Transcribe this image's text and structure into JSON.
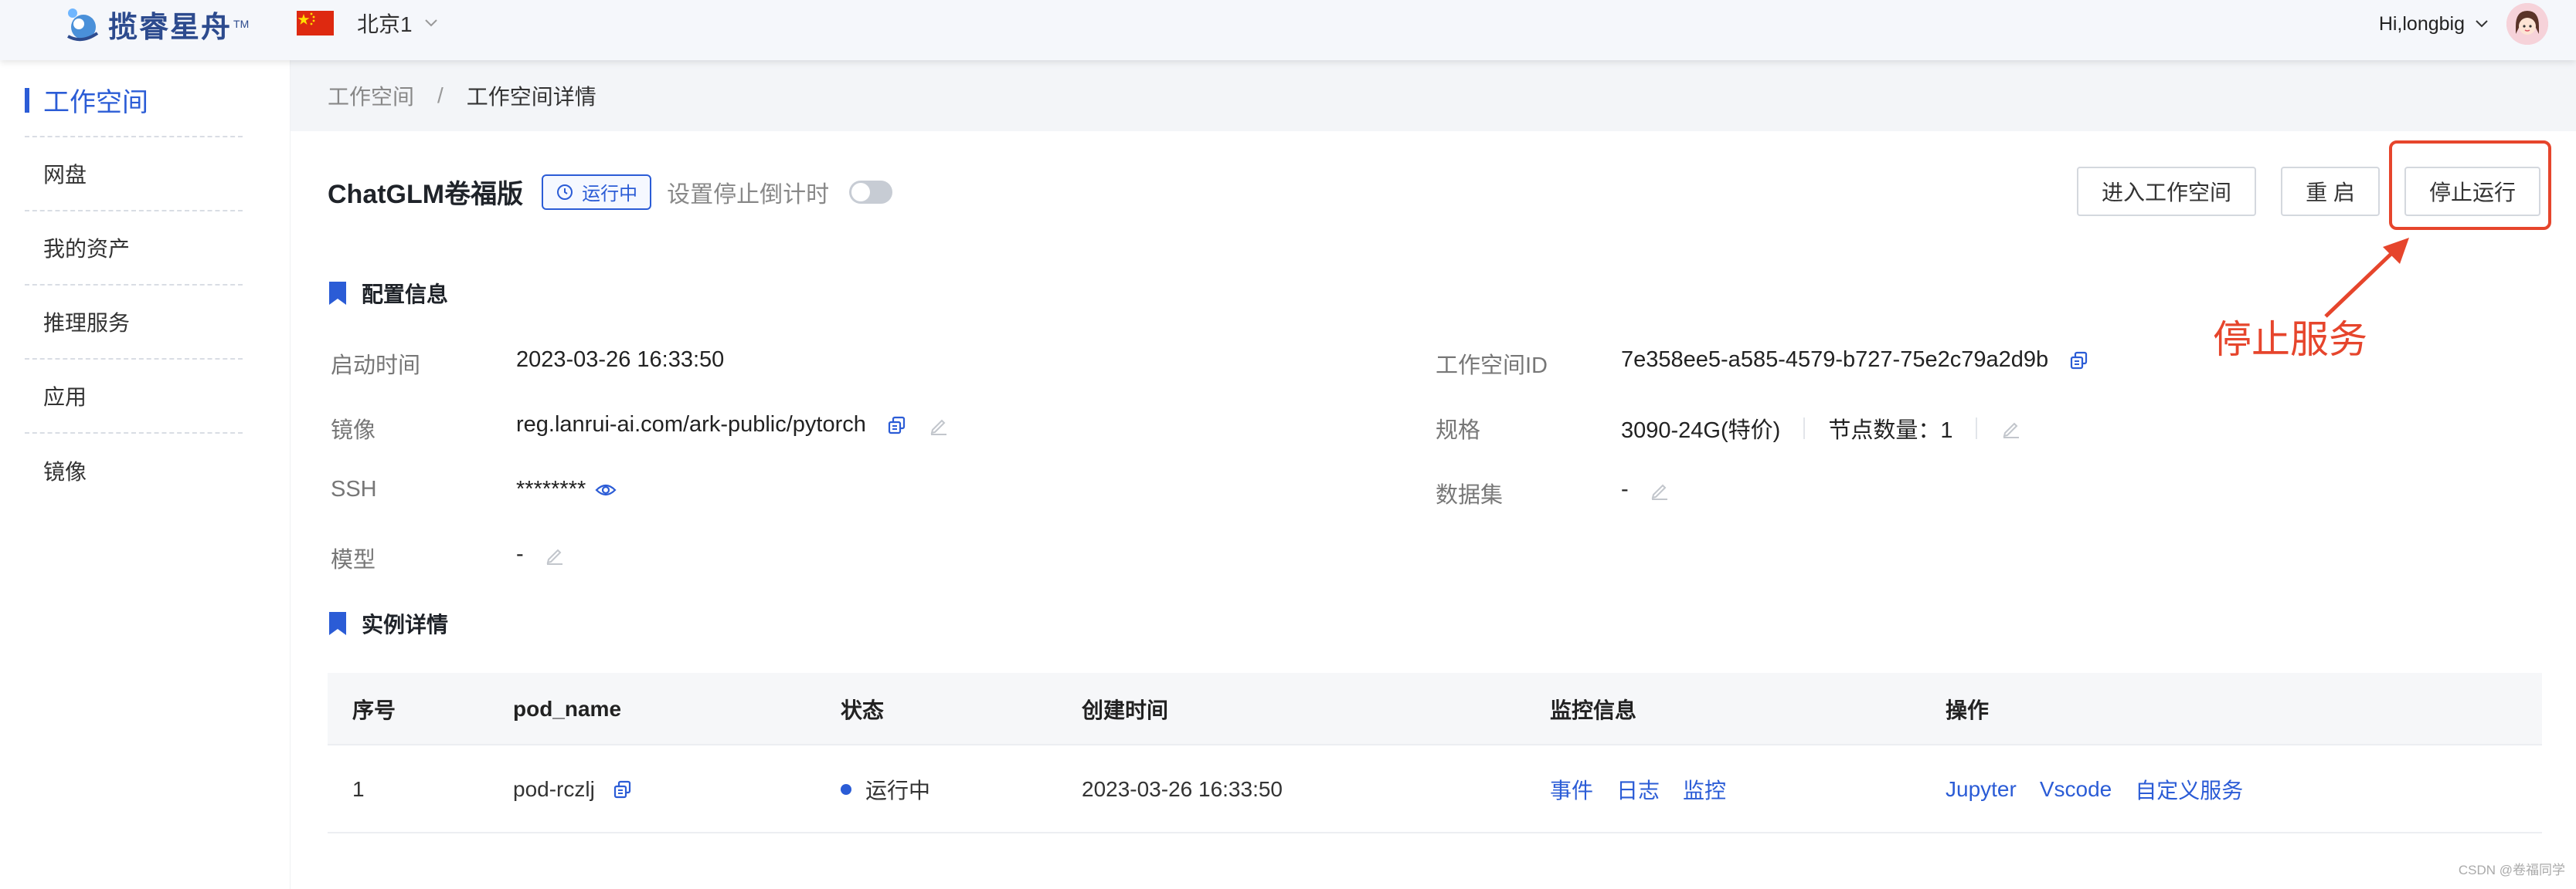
{
  "header": {
    "logo_text": "揽睿星舟",
    "logo_tm": "TM",
    "region": "北京1",
    "user_greeting": "Hi,longbig"
  },
  "sidebar": {
    "items": [
      {
        "label": "工作空间"
      },
      {
        "label": "网盘"
      },
      {
        "label": "我的资产"
      },
      {
        "label": "推理服务"
      },
      {
        "label": "应用"
      },
      {
        "label": "镜像"
      }
    ]
  },
  "breadcrumb": {
    "parent": "工作空间",
    "separator": "/",
    "current": "工作空间详情"
  },
  "workspace": {
    "title": "ChatGLM卷福版",
    "status": "运行中",
    "countdown_label": "设置停止倒计时",
    "countdown_enabled": false
  },
  "actions": {
    "enter": "进入工作空间",
    "restart": "重 启",
    "stop": "停止运行"
  },
  "annotation": {
    "text": "停止服务",
    "color": "#e6452c"
  },
  "config": {
    "heading": "配置信息",
    "left": [
      {
        "label": "启动时间",
        "value": "2023-03-26 16:33:50"
      },
      {
        "label": "镜像",
        "value": "reg.lanrui-ai.com/ark-public/pytorch"
      },
      {
        "label": "SSH",
        "value": "********"
      },
      {
        "label": "模型",
        "value": "-"
      }
    ],
    "right": [
      {
        "label": "工作空间ID",
        "value": "7e358ee5-a585-4579-b727-75e2c79a2d9b"
      },
      {
        "label": "规格",
        "value": "3090-24G(特价)",
        "extra": "节点数量：1"
      },
      {
        "label": "数据集",
        "value": "-"
      }
    ]
  },
  "instances": {
    "heading": "实例详情",
    "columns": [
      "序号",
      "pod_name",
      "状态",
      "创建时间",
      "监控信息",
      "操作"
    ],
    "rows": [
      {
        "index": "1",
        "pod_name": "pod-rczlj",
        "status": "运行中",
        "created": "2023-03-26 16:33:50",
        "monitor_links": [
          "事件",
          "日志",
          "监控"
        ],
        "action_links": [
          "Jupyter",
          "Vscode",
          "自定义服务"
        ]
      }
    ]
  },
  "watermark": "CSDN @卷福同学",
  "colors": {
    "accent": "#2b5cd6",
    "annotation": "#e6452c"
  }
}
